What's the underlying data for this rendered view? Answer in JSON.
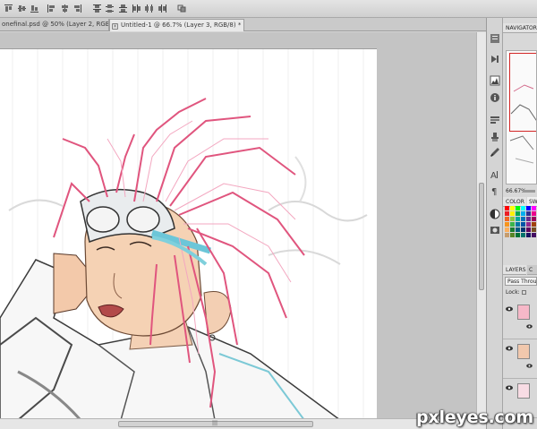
{
  "options_bar": {
    "buttons": [
      "align-top-icon",
      "align-vcenter-icon",
      "align-bottom-icon",
      "align-left-icon",
      "align-hcenter-icon",
      "align-right-icon",
      "distribute-top-icon",
      "distribute-vcenter-icon",
      "distribute-bottom-icon",
      "distribute-left-icon",
      "distribute-hcenter-icon",
      "distribute-right-icon",
      "auto-align-icon"
    ]
  },
  "document_tabs": [
    {
      "label": "onefinal.psd @ 50% (Layer 2, RGB/8)",
      "active": false
    },
    {
      "label": "Untitled-1 @ 66.7% (Layer 3, RGB/8) *",
      "active": true
    }
  ],
  "panels": {
    "navigator_tab": "NAVIGATOR",
    "zoom_value": "66.67%",
    "color_tab": "COLOR",
    "swatches_tab": "SW",
    "layers_tab": "LAYERS",
    "channels_tab": "C",
    "blend_mode": "Pass Through",
    "lock_label": "Lock:"
  },
  "tools": [
    "history-icon",
    "actions-icon",
    "histogram-icon",
    "info-icon",
    "layer-comps-icon",
    "clone-source-icon",
    "brush-presets-icon",
    "character-icon",
    "paragraph-icon",
    "adjustments-icon",
    "masks-icon"
  ],
  "swatch_colors": [
    "#ff0000",
    "#ffff00",
    "#00ff00",
    "#00ffff",
    "#0000ff",
    "#ff00ff",
    "#ffffff",
    "#ed1c24",
    "#fff200",
    "#00a651",
    "#00aeef",
    "#2e3192",
    "#ec008c",
    "#c7c7c7",
    "#f26522",
    "#8dc63f",
    "#00a99d",
    "#0072bc",
    "#662d91",
    "#9e005d",
    "#959595",
    "#f7941d",
    "#39b54a",
    "#0076a3",
    "#0054a6",
    "#92278f",
    "#a0410d",
    "#555555",
    "#fbaf5d",
    "#1a7b30",
    "#005b7f",
    "#003471",
    "#630460",
    "#754c24",
    "#363636",
    "#c69c6d",
    "#598527",
    "#007236",
    "#00746b",
    "#1b1464",
    "#440e62",
    "#000000"
  ],
  "watermark": "pxleyes.com"
}
